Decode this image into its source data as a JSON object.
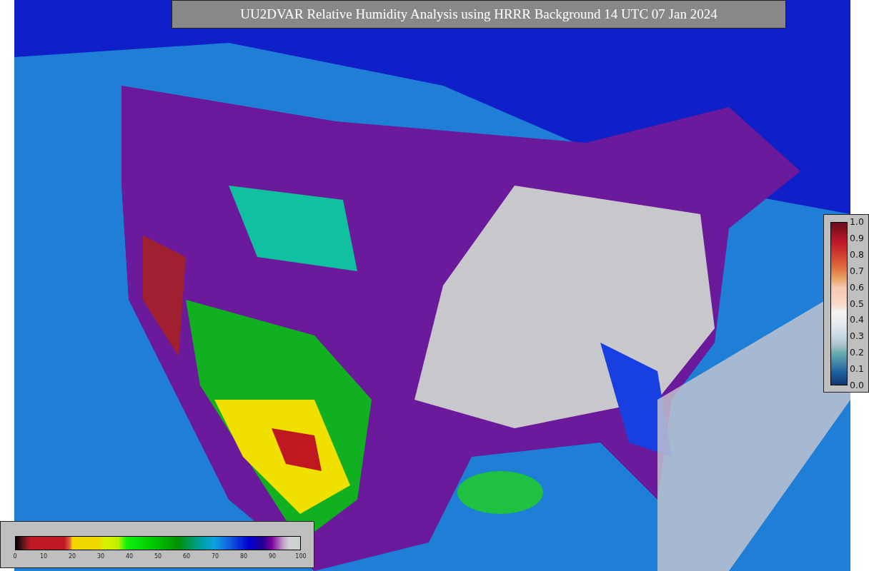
{
  "title": "UU2DVAR Relative Humidity Analysis using HRRR Background 14 UTC 07 Jan 2024",
  "station_colorbar": {
    "ticks": [
      "1.0",
      "0.9",
      "0.8",
      "0.7",
      "0.6",
      "0.5",
      "0.4",
      "0.3",
      "0.2",
      "0.1",
      "0.0"
    ]
  },
  "humidity_colorbar": {
    "ticks": [
      "0",
      "10",
      "20",
      "30",
      "40",
      "50",
      "60",
      "70",
      "80",
      "90",
      "100"
    ]
  }
}
